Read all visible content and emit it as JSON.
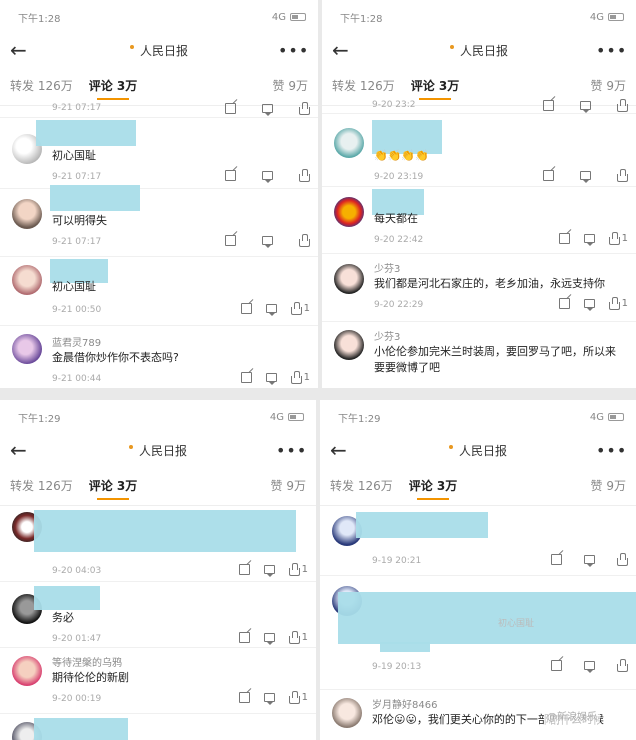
{
  "status": {
    "time_a": "下午1:28",
    "time_b": "下午1:29",
    "network": "4G"
  },
  "nav": {
    "title": "人民日报",
    "logo_text": "人民日报"
  },
  "tabs": {
    "repost": "转发 126万",
    "comment": "评论 3万",
    "like": "赞 9万"
  },
  "panels": [
    {
      "items": [
        {
          "name": "",
          "text": "",
          "time": "9-21 07:17"
        },
        {
          "name": "",
          "text": "初心国耻",
          "time": "9-21 07:17"
        },
        {
          "name": "",
          "text": "可以明得失",
          "time": "9-21 07:17"
        },
        {
          "name": "",
          "text": "初心国耻",
          "time": "9-21 00:50",
          "likes": "1"
        },
        {
          "name": "蓝君灵789",
          "text": "金晨借你炒作你不表态吗?",
          "time": "9-21 00:44",
          "likes": "1"
        }
      ]
    },
    {
      "items": [
        {
          "name": "",
          "text": "",
          "time": "9-20 23:2"
        },
        {
          "name": "",
          "text": "👏👏👏👏",
          "time": "9-20 23:19"
        },
        {
          "name": "",
          "text": "每天都在",
          "time": "9-20 22:42",
          "likes": "1"
        },
        {
          "name": "少芬3",
          "text": "我们都是河北石家庄的，老乡加油，永远支持你",
          "time": "9-20 22:29",
          "likes": "1"
        },
        {
          "name": "少芬3",
          "text": "小伦伦参加完米兰时装周，要回罗马了吧，所以来要要微博了吧",
          "time": ""
        }
      ]
    },
    {
      "items": [
        {
          "name": "",
          "text": "",
          "time": "9-20 04:03",
          "likes": "1"
        },
        {
          "name": "",
          "text": "务必",
          "time": "9-20 01:47",
          "likes": "1"
        },
        {
          "name": "等待涅槃的乌鸦",
          "text": "期待伦伦的新剧",
          "time": "9-20 00:19",
          "likes": "1"
        }
      ]
    },
    {
      "items": [
        {
          "name": "",
          "text": "",
          "time": "9-19 20:21"
        },
        {
          "name": "",
          "text": "",
          "time": "9-19 20:13",
          "tag": "初心国耻"
        },
        {
          "name": "岁月静好8466",
          "text": "邓伦😛😛，我们更关心你的的下一部剧什么时候",
          "time": ""
        }
      ]
    }
  ],
  "watermark": "@新浪娱乐"
}
